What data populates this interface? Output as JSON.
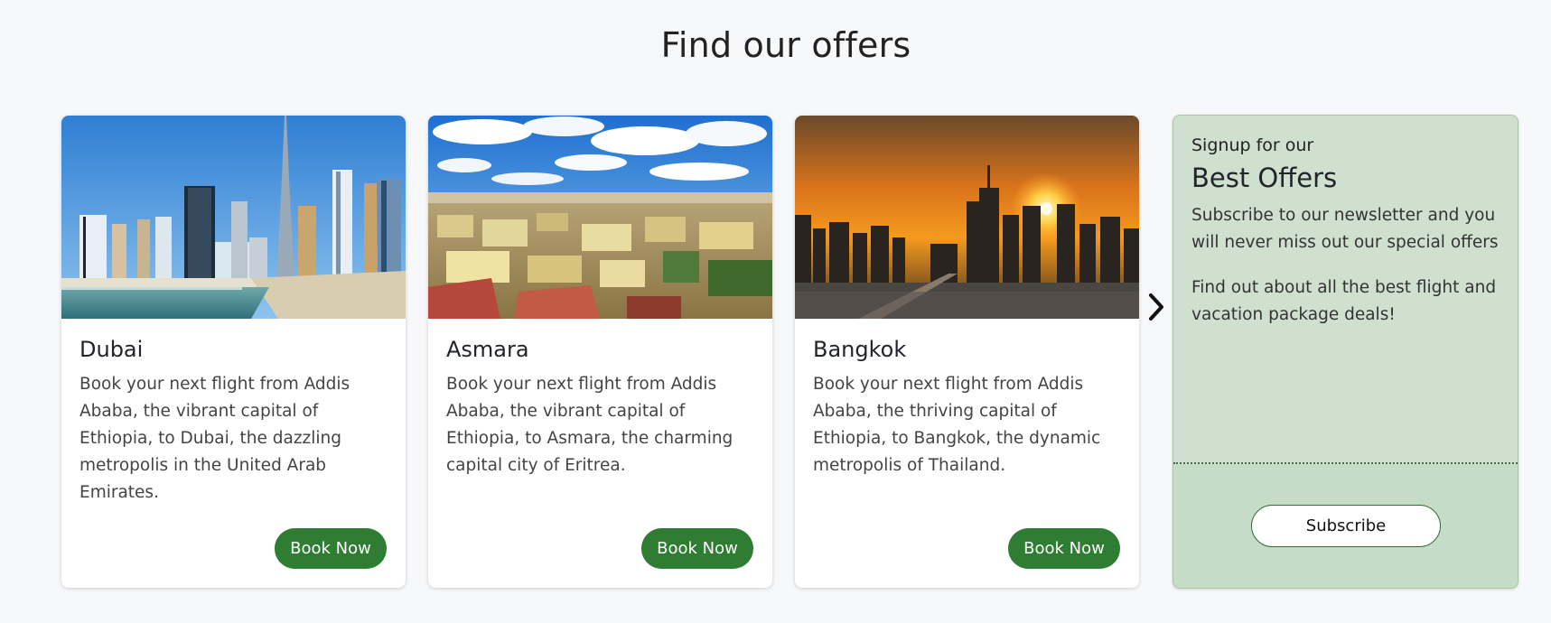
{
  "section": {
    "title": "Find our offers"
  },
  "cards": [
    {
      "image_name": "dubai-skyline-image",
      "title": "Dubai",
      "text": "Book your next flight from Addis Ababa, the vibrant capital of Ethiopia, to Dubai, the dazzling metropolis in the United Arab Emirates.",
      "button": "Book Now"
    },
    {
      "image_name": "asmara-city-image",
      "title": "Asmara",
      "text": "Book your next flight from Addis Ababa, the vibrant capital of Ethiopia, to Asmara, the charming capital city of Eritrea.",
      "button": "Book Now"
    },
    {
      "image_name": "bangkok-sunset-image",
      "title": "Bangkok",
      "text": "Book your next flight from Addis Ababa, the thriving capital of Ethiopia, to Bangkok, the dynamic metropolis of Thailand.",
      "button": "Book Now"
    }
  ],
  "carousel": {
    "next_icon": "chevron-right-icon"
  },
  "signup": {
    "kicker": "Signup for our",
    "title": "Best Offers",
    "text1": "Subscribe to our newsletter and you will never miss out our special offers",
    "text2": "Find out about all the best flight and vacation package deals!",
    "button": "Subscribe"
  },
  "colors": {
    "button_green": "#2e7d32",
    "signup_bg": "#cfe0cf",
    "page_bg": "#f7f8fa"
  }
}
